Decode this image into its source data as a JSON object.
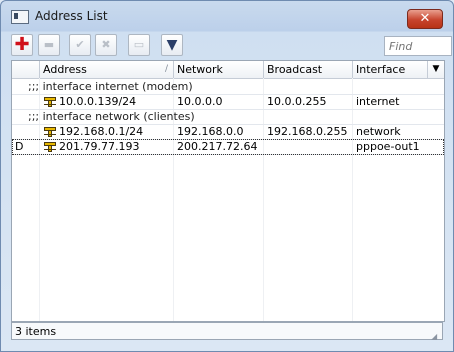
{
  "window": {
    "title": "Address List"
  },
  "toolbar": {
    "add_glyph": "✚",
    "remove_glyph": "▬",
    "enable_glyph": "✔",
    "disable_glyph": "✖",
    "comment_glyph": "▭",
    "filter_glyph": "▼",
    "find_placeholder": "Find"
  },
  "table": {
    "columns": [
      "Address",
      "Network",
      "Broadcast",
      "Interface"
    ],
    "sort_indicator": "∕",
    "dropdown_glyph": "▼",
    "rows": [
      {
        "type": "comment",
        "text": ";;; interface internet (modem)"
      },
      {
        "type": "data",
        "status": "",
        "address": "10.0.0.139/24",
        "network": "10.0.0.0",
        "broadcast": "10.0.0.255",
        "interface": "internet"
      },
      {
        "type": "comment",
        "text": ";;; interface network (clientes)"
      },
      {
        "type": "data",
        "status": "",
        "address": "192.168.0.1/24",
        "network": "192.168.0.0",
        "broadcast": "192.168.0.255",
        "interface": "network"
      },
      {
        "type": "data",
        "status": "D",
        "address": "201.79.77.193",
        "network": "200.217.72.64",
        "broadcast": "",
        "interface": "pppoe-out1"
      }
    ]
  },
  "status": {
    "item_count": "3 items"
  },
  "colors": {
    "add": "#d0101a",
    "icon_yellow": "#e8b800",
    "icon_outline": "#4a3a10"
  }
}
